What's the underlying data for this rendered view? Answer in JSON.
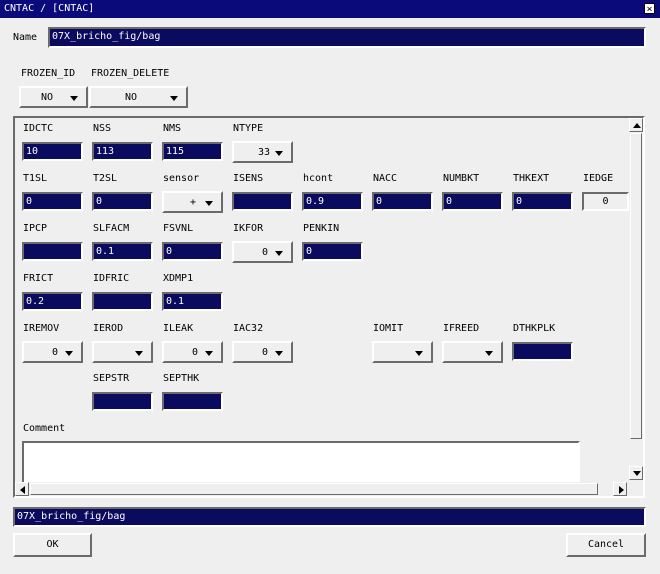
{
  "window": {
    "title": "CNTAC /   [CNTAC]",
    "close_glyph": "×"
  },
  "name_field": {
    "label": "Name",
    "value": "07X_bricho_fig/bag"
  },
  "frozen": {
    "id_label": "FROZEN_ID",
    "id_value": "NO",
    "delete_label": "FROZEN_DELETE",
    "delete_value": "NO"
  },
  "labels": {
    "idctc": "IDCTC",
    "nss": "NSS",
    "nms": "NMS",
    "ntype": "NTYPE",
    "t1sl": "T1SL",
    "t2sl": "T2SL",
    "sensor": "sensor",
    "isens": "ISENS",
    "hcont": "hcont",
    "nacc": "NACC",
    "numbkt": "NUMBKT",
    "thkext": "THKEXT",
    "iedge": "IEDGE",
    "ipcp": "IPCP",
    "slfacm": "SLFACM",
    "fsvnl": "FSVNL",
    "ikfor": "IKFOR",
    "penkin": "PENKIN",
    "frict": "FRICT",
    "idfric": "IDFRIC",
    "xdmp1": "XDMP1",
    "iremov": "IREMOV",
    "ierod": "IEROD",
    "ileak": "ILEAK",
    "iac32": "IAC32",
    "iomit": "IOMIT",
    "ifreed": "IFREED",
    "dthkplk": "DTHKPLK",
    "sepstr": "SEPSTR",
    "septhk": "SEPTHK",
    "comment": "Comment"
  },
  "values": {
    "idctc": "10",
    "nss": "113",
    "nms": "115",
    "ntype": "33",
    "t1sl": "0",
    "t2sl": "0",
    "sensor": "+",
    "isens": "",
    "hcont": "0.9",
    "nacc": "0",
    "numbkt": "0",
    "thkext": "0",
    "iedge": "0",
    "ipcp": "",
    "slfacm": "0.1",
    "fsvnl": "0",
    "ikfor": "0",
    "penkin": "0",
    "frict": "0.2",
    "idfric": "",
    "xdmp1": "0.1",
    "iremov": "0",
    "ierod": "",
    "ileak": "0",
    "iac32": "0",
    "iomit": "",
    "ifreed": "",
    "dthkplk": "",
    "sepstr": "",
    "septhk": "",
    "comment": ""
  },
  "status_bar": {
    "text": "07X_bricho_fig/bag"
  },
  "buttons": {
    "ok": "OK",
    "cancel": "Cancel"
  }
}
